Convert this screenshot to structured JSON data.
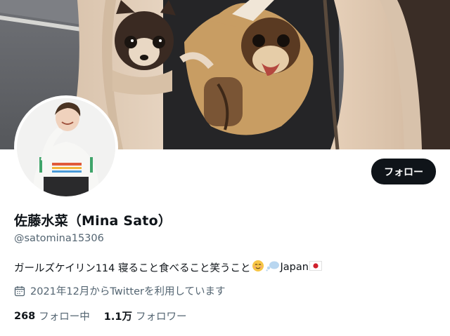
{
  "profile": {
    "display_name": "佐藤水菜（Mina Sato）",
    "handle": "@satomina15306",
    "bio_text": "ガールズケイリン114 寝ること食べること笑うこと",
    "bio_emojis": [
      "relieved-face-emoji",
      "thought-bubble-emoji"
    ],
    "bio_suffix": "Japan",
    "bio_flag": "japan-flag-emoji",
    "joined": "2021年12月からTwitterを利用しています",
    "following_count": "268",
    "following_label": "フォロー中",
    "followers_count": "1.1万",
    "followers_label": "フォロワー"
  },
  "actions": {
    "follow_label": "フォロー"
  },
  "icons": {
    "joined": "calendar-icon"
  },
  "colors": {
    "primary_text": "#0f1419",
    "secondary_text": "#536471",
    "follow_button_bg": "#0f1419",
    "follow_button_text": "#ffffff"
  }
}
